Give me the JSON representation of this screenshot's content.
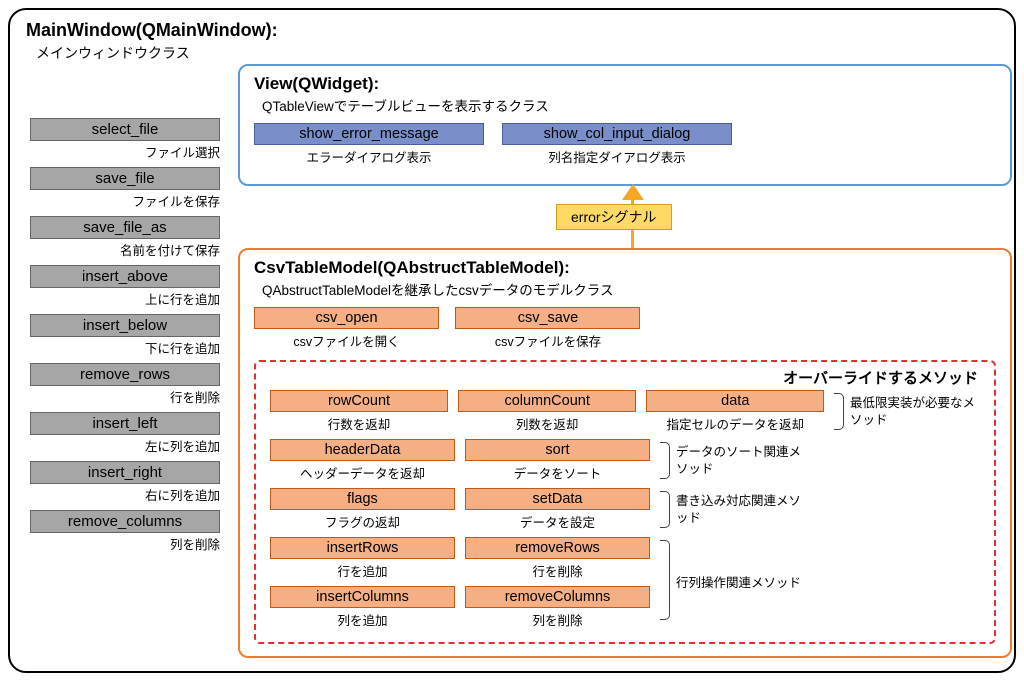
{
  "main": {
    "title": "MainWindow(QMainWindow):",
    "subtitle": "メインウィンドウクラス"
  },
  "sidebar": [
    {
      "name": "select_file",
      "desc": "ファイル選択"
    },
    {
      "name": "save_file",
      "desc": "ファイルを保存"
    },
    {
      "name": "save_file_as",
      "desc": "名前を付けて保存"
    },
    {
      "name": "insert_above",
      "desc": "上に行を追加"
    },
    {
      "name": "insert_below",
      "desc": "下に行を追加"
    },
    {
      "name": "remove_rows",
      "desc": "行を削除"
    },
    {
      "name": "insert_left",
      "desc": "左に列を追加"
    },
    {
      "name": "insert_right",
      "desc": "右に列を追加"
    },
    {
      "name": "remove_columns",
      "desc": "列を削除"
    }
  ],
  "view": {
    "title": "View(QWidget):",
    "subtitle": "QTableViewでテーブルビューを表示するクラス",
    "methods": [
      {
        "name": "show_error_message",
        "desc": "エラーダイアログ表示"
      },
      {
        "name": "show_col_input_dialog",
        "desc": "列名指定ダイアログ表示"
      }
    ]
  },
  "signal": "errorシグナル",
  "model": {
    "title": "CsvTableModel(QAbstructTableModel):",
    "subtitle": "QAbstructTableModelを継承したcsvデータのモデルクラス",
    "methods": [
      {
        "name": "csv_open",
        "desc": "csvファイルを開く"
      },
      {
        "name": "csv_save",
        "desc": "csvファイルを保存"
      }
    ],
    "override_title": "オーバーライドするメソッド",
    "groups": {
      "min": {
        "desc": "最低限実装が必要なメソッド",
        "items": [
          {
            "name": "rowCount",
            "desc": "行数を返却"
          },
          {
            "name": "columnCount",
            "desc": "列数を返却"
          },
          {
            "name": "data",
            "desc": "指定セルのデータを返却"
          }
        ]
      },
      "sort": {
        "desc": "データのソート関連メソッド",
        "items": [
          {
            "name": "headerData",
            "desc": "ヘッダーデータを返却"
          },
          {
            "name": "sort",
            "desc": "データをソート"
          }
        ]
      },
      "write": {
        "desc": "書き込み対応関連メソッド",
        "items": [
          {
            "name": "flags",
            "desc": "フラグの返却"
          },
          {
            "name": "setData",
            "desc": "データを設定"
          }
        ]
      },
      "rowcol": {
        "desc": "行列操作関連メソッド",
        "row1": [
          {
            "name": "insertRows",
            "desc": "行を追加"
          },
          {
            "name": "removeRows",
            "desc": "行を削除"
          }
        ],
        "row2": [
          {
            "name": "insertColumns",
            "desc": "列を追加"
          },
          {
            "name": "removeColumns",
            "desc": "列を削除"
          }
        ]
      }
    }
  }
}
